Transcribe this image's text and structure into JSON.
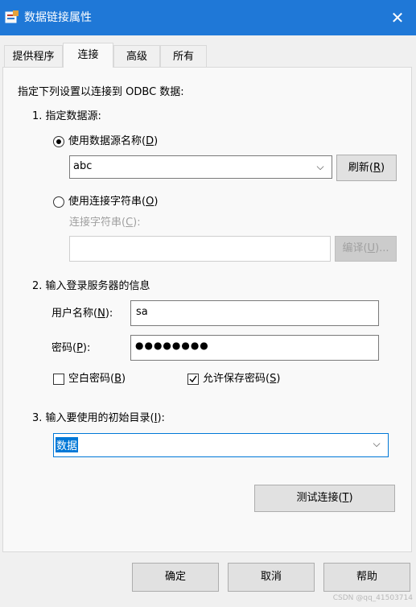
{
  "window": {
    "title": "数据链接属性",
    "close_glyph": "✕"
  },
  "tabs": [
    {
      "label": "提供程序"
    },
    {
      "label": "连接"
    },
    {
      "label": "高级"
    },
    {
      "label": "所有"
    }
  ],
  "connection": {
    "intro": "指定下列设置以连接到 ODBC 数据:",
    "step1": "1. 指定数据源:",
    "use_dsn": {
      "label_prefix": "使用数据源名称(",
      "hotkey": "D",
      "label_suffix": ")"
    },
    "dsn_value": "abc",
    "refresh": {
      "prefix": "刷新(",
      "hotkey": "R",
      "suffix": ")"
    },
    "use_conn_str": {
      "label_prefix": "使用连接字符串(",
      "hotkey": "O",
      "label_suffix": ")"
    },
    "conn_str_label": {
      "prefix": "连接字符串(",
      "hotkey": "C",
      "suffix": "):"
    },
    "conn_str_value": "",
    "build": {
      "prefix": "编译(",
      "hotkey": "U",
      "suffix": ")..."
    },
    "step2": "2. 输入登录服务器的信息",
    "username_label": {
      "prefix": "用户名称(",
      "hotkey": "N",
      "suffix": "):"
    },
    "username_value": "sa",
    "password_label": {
      "prefix": "密码(",
      "hotkey": "P",
      "suffix": "):"
    },
    "password_value": "●●●●●●●●",
    "blank_password": {
      "prefix": "空白密码(",
      "hotkey": "B",
      "suffix": ")",
      "checked": false
    },
    "allow_save_password": {
      "prefix": "允许保存密码(",
      "hotkey": "S",
      "suffix": ")",
      "checked": true
    },
    "step3": {
      "prefix": "3. 输入要使用的初始目录(",
      "hotkey": "I",
      "suffix": "):"
    },
    "catalog_value": "数据",
    "test_connection": {
      "prefix": "测试连接(",
      "hotkey": "T",
      "suffix": ")"
    }
  },
  "footer": {
    "ok": "确定",
    "cancel": "取消",
    "help": "帮助"
  },
  "watermark": "CSDN @qq_41503714",
  "colors": {
    "titlebar": "#1f78d7",
    "selection": "#0078d7"
  }
}
